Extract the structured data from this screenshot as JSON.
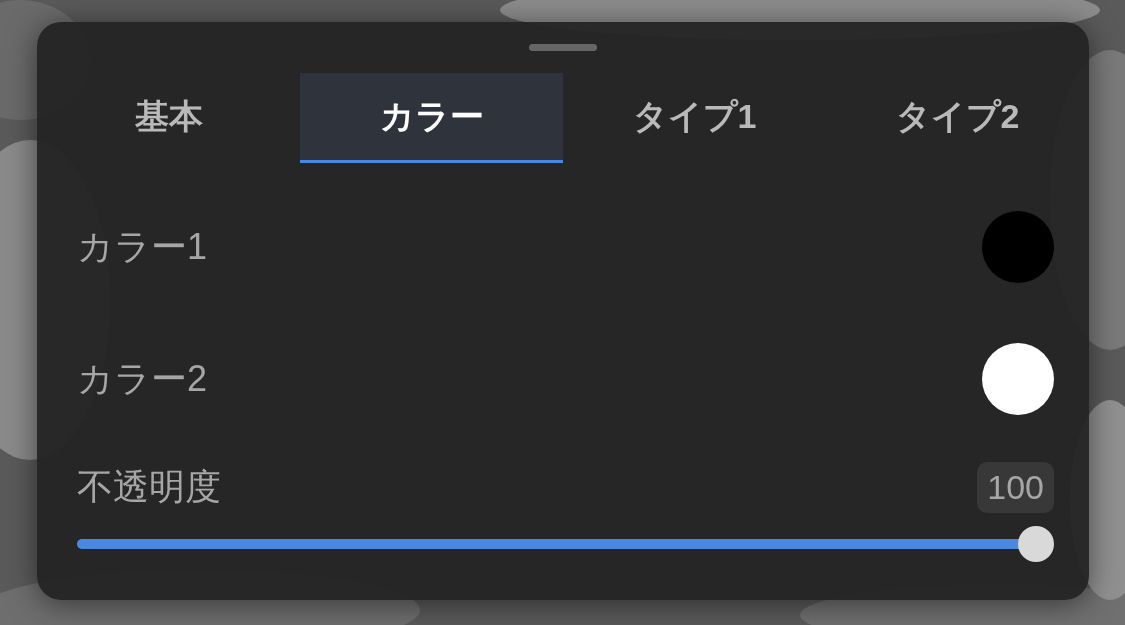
{
  "tabs": [
    {
      "label": "基本",
      "selected": false
    },
    {
      "label": "カラー",
      "selected": true
    },
    {
      "label": "タイプ1",
      "selected": false
    },
    {
      "label": "タイプ2",
      "selected": false
    }
  ],
  "colors": [
    {
      "label": "カラー1",
      "color": "#000000"
    },
    {
      "label": "カラー2",
      "color": "#ffffff"
    }
  ],
  "opacity": {
    "label": "不透明度",
    "value": "100",
    "level": 1
  }
}
